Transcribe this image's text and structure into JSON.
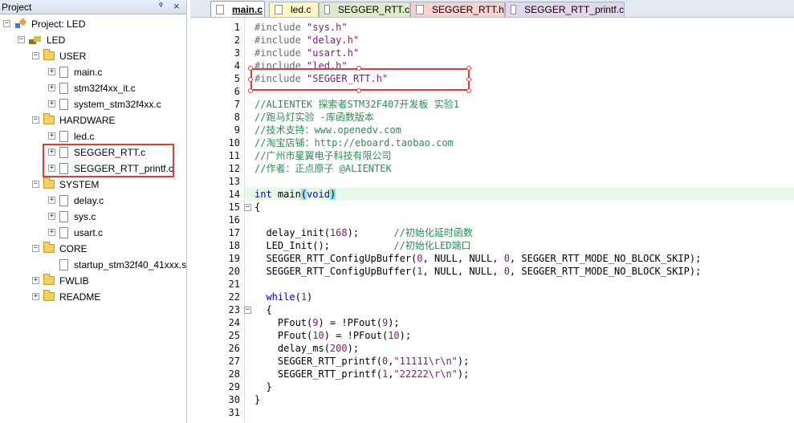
{
  "project_pane": {
    "title": "Project",
    "pin_icon": "pin-icon",
    "close_icon": "close-icon",
    "tree": [
      {
        "label": "Project: LED",
        "type": "project",
        "expander": "-"
      },
      {
        "label": "LED",
        "type": "target",
        "expander": "-"
      },
      {
        "label": "USER",
        "type": "folder",
        "expander": "-"
      },
      {
        "label": "main.c",
        "type": "file",
        "expander": "+"
      },
      {
        "label": "stm32f4xx_it.c",
        "type": "file",
        "expander": "+"
      },
      {
        "label": "system_stm32f4xx.c",
        "type": "file",
        "expander": "+"
      },
      {
        "label": "HARDWARE",
        "type": "folder",
        "expander": "-"
      },
      {
        "label": "led.c",
        "type": "file",
        "expander": "+"
      },
      {
        "label": "SEGGER_RTT.c",
        "type": "file",
        "expander": "+"
      },
      {
        "label": "SEGGER_RTT_printf.c",
        "type": "file",
        "expander": "+"
      },
      {
        "label": "SYSTEM",
        "type": "folder",
        "expander": "-"
      },
      {
        "label": "delay.c",
        "type": "file",
        "expander": "+"
      },
      {
        "label": "sys.c",
        "type": "file",
        "expander": "+"
      },
      {
        "label": "usart.c",
        "type": "file",
        "expander": "+"
      },
      {
        "label": "CORE",
        "type": "folder",
        "expander": "-"
      },
      {
        "label": "startup_stm32f40_41xxx.s",
        "type": "file",
        "expander": ""
      },
      {
        "label": "FWLIB",
        "type": "folder",
        "expander": "+"
      },
      {
        "label": "README",
        "type": "folder",
        "expander": "+"
      }
    ]
  },
  "tabs": [
    {
      "label": "main.c",
      "active": true
    },
    {
      "label": "led.c",
      "active": false
    },
    {
      "label": "SEGGER_RTT.c",
      "active": false
    },
    {
      "label": "SEGGER_RTT.h",
      "active": false
    },
    {
      "label": "SEGGER_RTT_printf.c",
      "active": false
    }
  ],
  "code_lines": [
    {
      "n": "1",
      "fold": "",
      "html": "<span class='c-pre'>#include </span><span class='c-str'>\"sys.h\"</span>"
    },
    {
      "n": "2",
      "fold": "",
      "html": "<span class='c-pre'>#include </span><span class='c-str'>\"delay.h\"</span>"
    },
    {
      "n": "3",
      "fold": "",
      "html": "<span class='c-pre'>#include </span><span class='c-str'>\"usart.h\"</span>"
    },
    {
      "n": "4",
      "fold": "",
      "html": "<span class='c-pre'>#include </span><span class='c-str'>\"led.h\"</span>"
    },
    {
      "n": "5",
      "fold": "",
      "html": "<span class='c-pre'>#include </span><span class='c-str'>\"SEGGER_RTT.h\"</span>"
    },
    {
      "n": "6",
      "fold": "",
      "html": ""
    },
    {
      "n": "7",
      "fold": "",
      "html": "<span class='c-cmt'>//ALIENTEK 探索者STM32F407开发板 实验1</span>"
    },
    {
      "n": "8",
      "fold": "",
      "html": "<span class='c-cmt'>//跑马灯实验 -库函数版本</span>"
    },
    {
      "n": "9",
      "fold": "",
      "html": "<span class='c-cmt'>//技术支持：www.openedv.com</span>"
    },
    {
      "n": "10",
      "fold": "",
      "html": "<span class='c-cmt'>//淘宝店铺：http://eboard.taobao.com</span>"
    },
    {
      "n": "11",
      "fold": "",
      "html": "<span class='c-cmt'>//广州市星翼电子科技有限公司</span>"
    },
    {
      "n": "12",
      "fold": "",
      "html": "<span class='c-cmt'>//作者：正点原子 @ALIENTEK</span>"
    },
    {
      "n": "13",
      "fold": "",
      "html": ""
    },
    {
      "n": "14",
      "fold": "",
      "html": "<span class='c-kw'>int</span> main<span class='c-brace'>(</span><span class='c-kw'>void</span><span class='c-brace'>)</span>"
    },
    {
      "n": "15",
      "fold": "-",
      "html": "{"
    },
    {
      "n": "16",
      "fold": "",
      "html": ""
    },
    {
      "n": "17",
      "fold": "",
      "html": "  delay_init(<span class='c-num'>168</span>);      <span class='c-cmt'>//初始化延时函数</span>"
    },
    {
      "n": "18",
      "fold": "",
      "html": "  LED_Init();           <span class='c-cmt'>//初始化LED端口</span>"
    },
    {
      "n": "19",
      "fold": "",
      "html": "  SEGGER_RTT_ConfigUpBuffer(<span class='c-num'>0</span>, NULL, NULL, <span class='c-num'>0</span>, SEGGER_RTT_MODE_NO_BLOCK_SKIP);"
    },
    {
      "n": "20",
      "fold": "",
      "html": "  SEGGER_RTT_ConfigUpBuffer(<span class='c-num'>1</span>, NULL, NULL, <span class='c-num'>0</span>, SEGGER_RTT_MODE_NO_BLOCK_SKIP);"
    },
    {
      "n": "21",
      "fold": "",
      "html": ""
    },
    {
      "n": "22",
      "fold": "",
      "html": "  <span class='c-kw'>while</span>(<span class='c-num'>1</span>)"
    },
    {
      "n": "23",
      "fold": "-",
      "html": "  {"
    },
    {
      "n": "24",
      "fold": "",
      "html": "    PFout(<span class='c-num'>9</span>) = !PFout(<span class='c-num'>9</span>);"
    },
    {
      "n": "25",
      "fold": "",
      "html": "    PFout(<span class='c-num'>10</span>) = !PFout(<span class='c-num'>10</span>);"
    },
    {
      "n": "26",
      "fold": "",
      "html": "    delay_ms(<span class='c-num'>200</span>);"
    },
    {
      "n": "27",
      "fold": "",
      "html": "    SEGGER_RTT_printf(<span class='c-num'>0</span>,<span class='c-str'>\"11111\\r\\n\"</span>);"
    },
    {
      "n": "28",
      "fold": "",
      "html": "    SEGGER_RTT_printf(<span class='c-num'>1</span>,<span class='c-str'>\"22222\\r\\n\"</span>);"
    },
    {
      "n": "29",
      "fold": "",
      "html": "  }"
    },
    {
      "n": "30",
      "fold": "",
      "html": "}"
    },
    {
      "n": "31",
      "fold": "",
      "html": ""
    }
  ],
  "current_line": "14",
  "colors": {
    "highlight_box": "#e03a3a",
    "current_line_bg": "#e6f8e8",
    "brace_match_bg": "#8be4f0"
  }
}
